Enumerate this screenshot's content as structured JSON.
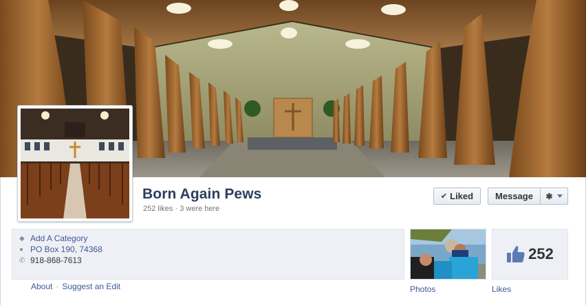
{
  "page": {
    "name": "Born Again Pews",
    "likes_text": "252 likes",
    "separator": " · ",
    "checkins_text": "3 were here"
  },
  "actions": {
    "liked_label": "Liked",
    "message_label": "Message"
  },
  "info": {
    "category_link": "Add A Category",
    "address": "PO Box 190, 74368",
    "phone": "918-868-7613"
  },
  "about_links": {
    "about": "About",
    "separator": "·",
    "suggest": "Suggest an Edit"
  },
  "apps": {
    "photos_label": "Photos",
    "likes_label": "Likes",
    "likes_count": "252"
  },
  "icons": {
    "liked": "check-icon",
    "settings": "gear-icon",
    "dropdown": "caret-down-icon",
    "category": "tag-icon",
    "address": "map-pin-icon",
    "phone": "phone-icon",
    "likes": "thumbs-up-icon"
  },
  "colors": {
    "link": "#3b5998",
    "title": "#2b3e5e",
    "panel": "#eef0f5"
  }
}
